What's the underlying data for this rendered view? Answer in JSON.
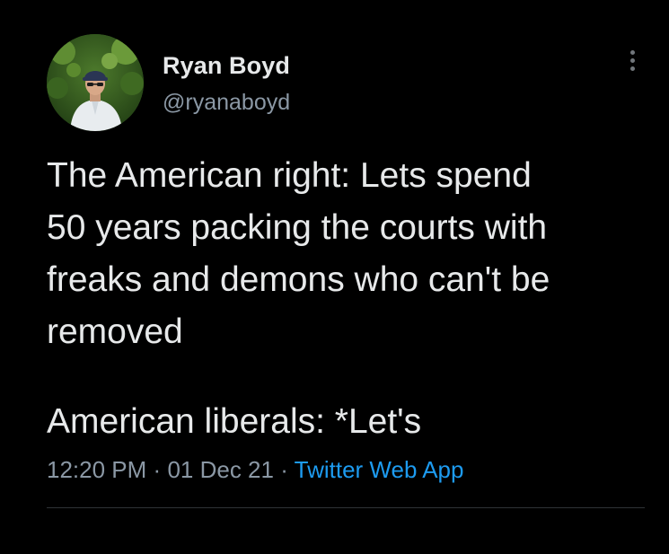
{
  "tweet": {
    "author": {
      "display_name": "Ryan Boyd",
      "handle": "@ryanaboyd",
      "avatar_icon": "profile-photo"
    },
    "text_part1": "The American right: Lets spend\n50 years packing the courts with\nfreaks and demons who can't be\nremoved",
    "text_part2": "American liberals: *Let's",
    "time": "12:20 PM",
    "separator": "·",
    "date": "01 Dec 21",
    "source": "Twitter Web App",
    "more_icon": "more-vertical-icon"
  },
  "colors": {
    "background": "#000000",
    "text_primary": "#e7e9ea",
    "text_secondary": "#8b98a5",
    "link": "#1d9bf0",
    "divider": "#2f3336"
  }
}
